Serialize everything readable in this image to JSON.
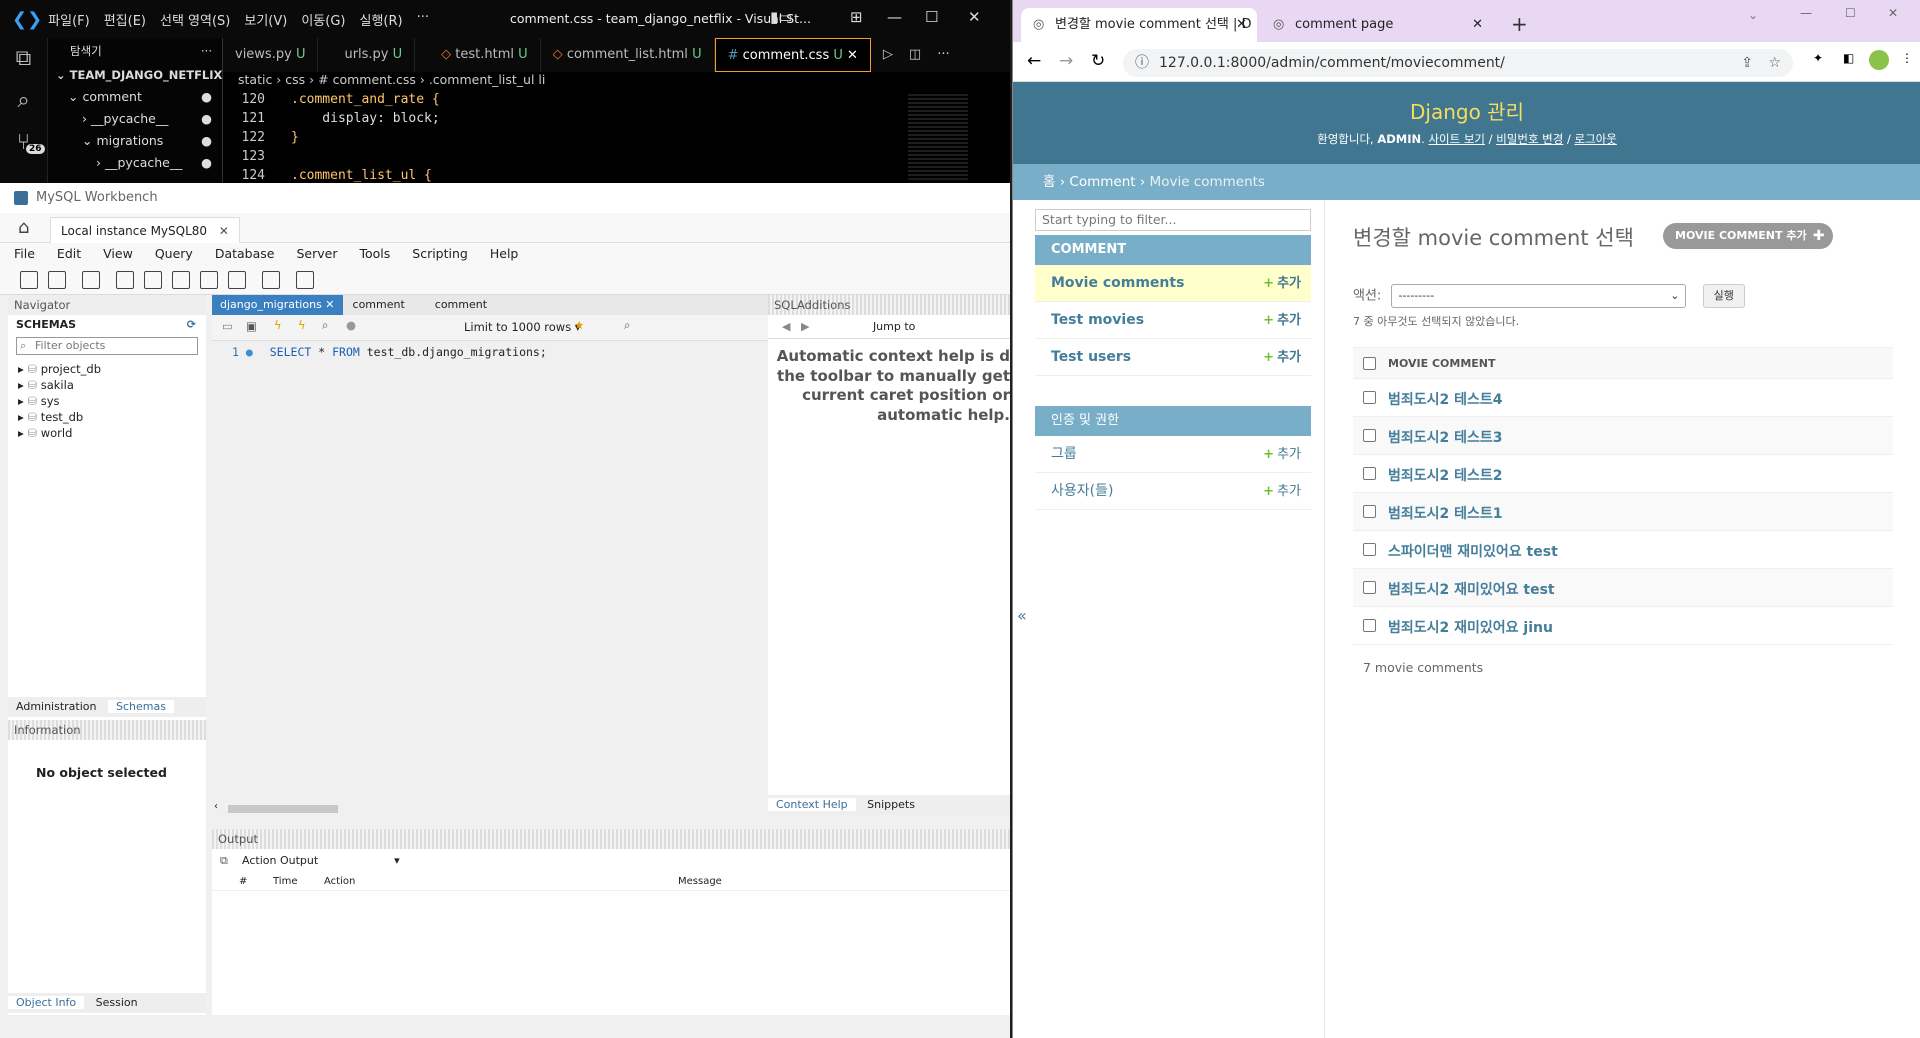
{
  "vscode": {
    "menu": [
      "파일(F)",
      "편집(E)",
      "선택 영역(S)",
      "보기(V)",
      "이동(G)",
      "실행(R)",
      "···"
    ],
    "window_title": "comment.css - team_django_netflix - Visual St...",
    "explorer": {
      "title": "탐색기",
      "project": "TEAM_DJANGO_NETFLIX",
      "items": [
        "comment",
        "__pycache__",
        "migrations",
        "__pycache__"
      ]
    },
    "tabs": [
      {
        "label": "views.py",
        "badge": "U"
      },
      {
        "label": "urls.py",
        "badge": "U"
      },
      {
        "label": "test.html",
        "badge": "U"
      },
      {
        "label": "comment_list.html",
        "badge": "U"
      },
      {
        "label": "comment.css",
        "badge": "U"
      }
    ],
    "breadcrumb": [
      "static",
      "css",
      "# comment.css",
      ".comment_list_ul li"
    ],
    "source_control_badge": "26",
    "code_lines": [
      {
        "n": "120",
        "text": ".comment_and_rate {"
      },
      {
        "n": "121",
        "text": "    display: block;"
      },
      {
        "n": "122",
        "text": "}"
      },
      {
        "n": "123",
        "text": ""
      },
      {
        "n": "124",
        "text": ".comment_list_ul {"
      }
    ]
  },
  "workbench": {
    "title": "MySQL Workbench",
    "instance_tab": "Local instance MySQL80",
    "menu": [
      "File",
      "Edit",
      "View",
      "Query",
      "Database",
      "Server",
      "Tools",
      "Scripting",
      "Help"
    ],
    "navigator_label": "Navigator",
    "schemas_label": "SCHEMAS",
    "filter_placeholder": "Filter objects",
    "schemas": [
      "project_db",
      "sakila",
      "sys",
      "test_db",
      "world"
    ],
    "nav_tabs": [
      "Administration",
      "Schemas"
    ],
    "information_label": "Information",
    "no_object": "No object selected",
    "bottom_tabs": [
      "Object Info",
      "Session"
    ],
    "editor_tabs": [
      "django_migrations",
      "comment",
      "comment"
    ],
    "limit_rows": "Limit to 1000 rows",
    "jump_to": "Jump to",
    "sql_line_no": "1",
    "sql": {
      "kw1": "SELECT",
      "star": "*",
      "kw2": "FROM",
      "rest": "test_db.django_migrations;"
    },
    "sql_additions": "SQLAdditions",
    "context_help": "Automatic context help is d the toolbar to manually get current caret position or automatic help.",
    "context_help_lines": [
      "Automatic context help is d",
      "the toolbar to manually get",
      "current caret position or",
      "automatic help."
    ],
    "context_tabs": [
      "Context Help",
      "Snippets"
    ],
    "output_label": "Output",
    "action_output": "Action Output",
    "output_cols": [
      "#",
      "Time",
      "Action",
      "Message"
    ]
  },
  "chrome": {
    "tabs": [
      "변경할 movie comment 선택 | D",
      "comment page"
    ],
    "url": "127.0.0.1:8000/admin/comment/moviecomment/"
  },
  "django": {
    "brand": "Django 관리",
    "welcome": "환영합니다,",
    "user": "ADMIN",
    "links": [
      "사이트 보기",
      "비밀번호 변경",
      "로그아웃"
    ],
    "breadcrumbs": [
      "홈",
      "Comment",
      "Movie comments"
    ],
    "filter_placeholder": "Start typing to filter...",
    "apps": [
      {
        "name": "COMMENT",
        "models": [
          "Movie comments",
          "Test movies",
          "Test users"
        ]
      },
      {
        "name": "인증 및 권한",
        "models": [
          "그룹",
          "사용자(들)"
        ]
      }
    ],
    "add_label": "추가",
    "page_title": "변경할 movie comment 선택",
    "add_button": "MOVIE COMMENT 추가",
    "action_label": "액션:",
    "action_selected": "---------",
    "go_button": "실행",
    "selection_note": "7 중 아무것도 선택되지 않았습니다.",
    "column_header": "MOVIE COMMENT",
    "rows": [
      "범죄도시2 테스트4",
      "범죄도시2 테스트3",
      "범죄도시2 테스트2",
      "범죄도시2 테스트1",
      "스파이더맨 재미있어요 test",
      "범죄도시2 재미있어요 test",
      "범죄도시2 재미있어요 jinu"
    ],
    "count": "7 movie comments",
    "collapse": "«"
  },
  "colors": {
    "django_header": "#417690",
    "django_breadcrumb": "#79aec8",
    "django_brand": "#f5dd5d",
    "vscode_accent": "#f0a030"
  }
}
